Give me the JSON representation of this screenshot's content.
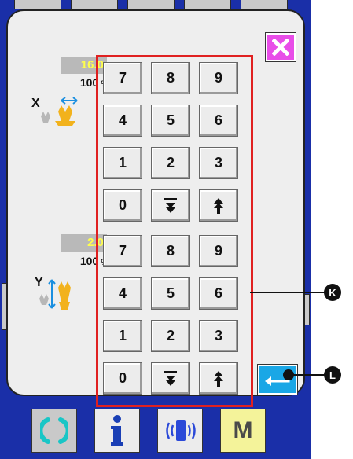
{
  "dialog": {
    "close_icon": "close-x-icon",
    "close_color": "#e84de8"
  },
  "x_section": {
    "value": "16.0",
    "percent": "100",
    "percent_unit": "%",
    "axis_letter": "X",
    "icon": "x-direction-scale-icon"
  },
  "y_section": {
    "value": "2.0",
    "percent": "100",
    "percent_unit": "%",
    "axis_letter": "Y",
    "icon": "y-direction-scale-icon"
  },
  "keypad_top": [
    "7",
    "8",
    "9",
    "4",
    "5",
    "6",
    "1",
    "2",
    "3",
    "0"
  ],
  "keypad_bottom": [
    "7",
    "8",
    "9",
    "4",
    "5",
    "6",
    "1",
    "2",
    "3",
    "0"
  ],
  "keypad_icons": [
    "step-down-icon",
    "step-up-icon"
  ],
  "enter_button": {
    "icon": "enter-return-icon",
    "color": "#1aa7e6"
  },
  "callouts": {
    "keypad": "K",
    "enter": "L"
  },
  "bottom_bar": {
    "buttons": [
      {
        "name": "reset",
        "icon": "reset-icon"
      },
      {
        "name": "info",
        "icon": "info-icon"
      },
      {
        "name": "communication",
        "icon": "communication-icon"
      },
      {
        "name": "mode",
        "label": "M"
      }
    ]
  },
  "colors": {
    "screen_bg": "#1a2fa8",
    "keypad_frame": "#e02020",
    "value_text": "#ffff4d"
  }
}
